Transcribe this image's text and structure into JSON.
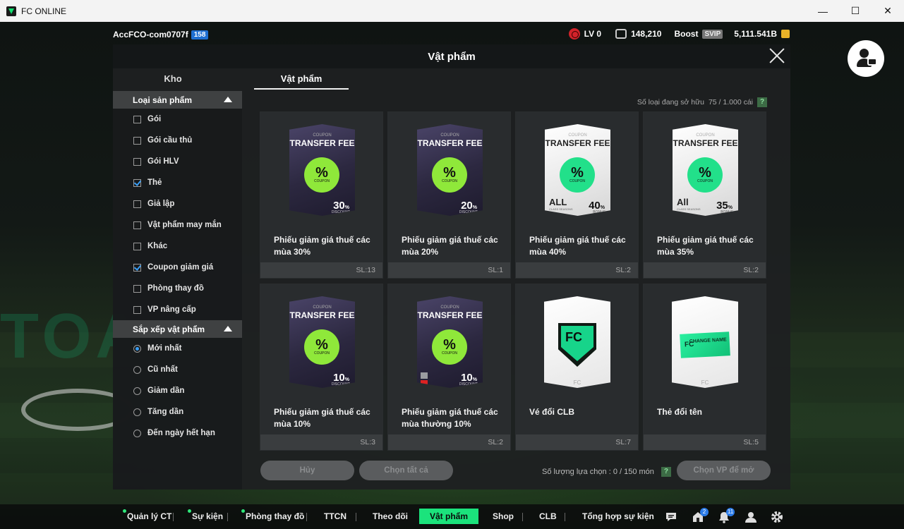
{
  "window": {
    "title": "FC ONLINE",
    "min": "—",
    "max": "☐",
    "close": "✕"
  },
  "bg_text": "TOA",
  "account": {
    "name": "AccFCO-com0707f",
    "level": "158"
  },
  "hud": {
    "lv": "LV 0",
    "bp": "148,210",
    "boost": "Boost",
    "svip": "SVIP",
    "coins": "5,111.541B"
  },
  "modal": {
    "title": "Vật phẩm",
    "tabs": [
      "Kho",
      "Vật phẩm"
    ],
    "owned_label": "Số loại đang sở hữu",
    "owned_value": "75 / 1.000 cái",
    "help": "?"
  },
  "filters": {
    "product_header": "Loại sản phẩm",
    "products": [
      {
        "label": "Gói",
        "checked": false
      },
      {
        "label": "Gói cầu thủ",
        "checked": false
      },
      {
        "label": "Gói HLV",
        "checked": false
      },
      {
        "label": "Thẻ",
        "checked": true
      },
      {
        "label": "Giả lập",
        "checked": false
      },
      {
        "label": "Vật phẩm may mắn",
        "checked": false
      },
      {
        "label": "Khác",
        "checked": false
      },
      {
        "label": "Coupon giảm giá",
        "checked": true
      },
      {
        "label": "Phòng thay đồ",
        "checked": false
      },
      {
        "label": "VP nâng cấp",
        "checked": false
      }
    ],
    "sort_header": "Sắp xếp vật phẩm",
    "sorts": [
      {
        "label": "Mới nhất",
        "selected": true
      },
      {
        "label": "Cũ nhất",
        "selected": false
      },
      {
        "label": "Giảm dần",
        "selected": false
      },
      {
        "label": "Tăng dần",
        "selected": false
      },
      {
        "label": "Đến ngày hết hạn",
        "selected": false
      }
    ]
  },
  "items": [
    {
      "name": "Phiếu giảm giá thuế các mùa 30%",
      "qty": "SL:13",
      "kind": "coupon",
      "style": "dark",
      "coupon_label": "COUPON",
      "title": "TRANSFER FEE",
      "seal": "%",
      "seal_sub": "COUPON",
      "pct": "30",
      "pct_sub": "DISCOUNT"
    },
    {
      "name": "Phiếu giảm giá thuế các mùa 20%",
      "qty": "SL:1",
      "kind": "coupon",
      "style": "dark",
      "coupon_label": "COUPON",
      "title": "TRANSFER FEE",
      "seal": "%",
      "seal_sub": "COUPON",
      "pct": "20",
      "pct_sub": "DISCOUNT"
    },
    {
      "name": "Phiếu giảm giá thuế các mùa 40%",
      "qty": "SL:2",
      "kind": "coupon",
      "style": "light",
      "coupon_label": "COUPON",
      "title": "TRANSFER FEE",
      "seal": "%",
      "seal_sub": "COUPON",
      "pct": "40",
      "pct_sub": "BONUS",
      "all": "ALL",
      "all_sub": "CLASS SEASONS"
    },
    {
      "name": "Phiếu giảm giá thuế các mùa 35%",
      "qty": "SL:2",
      "kind": "coupon",
      "style": "light",
      "coupon_label": "COUPON",
      "title": "TRANSFER FEE",
      "seal": "%",
      "seal_sub": "COUPON",
      "pct": "35",
      "pct_sub": "BONUS",
      "all": "All",
      "all_sub": "CLASS SEASONS"
    },
    {
      "name": "Phiếu giảm giá thuế các mùa 10%",
      "qty": "SL:3",
      "kind": "coupon",
      "style": "dark",
      "coupon_label": "COUPON",
      "title": "TRANSFER FEE",
      "seal": "%",
      "seal_sub": "COUPON",
      "pct": "10",
      "pct_sub": "DISCOUNT"
    },
    {
      "name": "Phiếu giảm giá thuế các mùa thường 10%",
      "qty": "SL:2",
      "kind": "coupon",
      "style": "dark",
      "coupon_label": "COUPON",
      "title": "TRANSFER FEE",
      "seal": "%",
      "seal_sub": "COUPON",
      "pct": "10",
      "pct_sub": "DISCOUNT",
      "locked": true
    },
    {
      "name": "Vé đổi CLB",
      "qty": "SL:7",
      "kind": "club",
      "emblem": "FC",
      "foot": "FC"
    },
    {
      "name": "Thẻ đổi tên",
      "qty": "SL:5",
      "kind": "rename",
      "ticket": "CHANGE NAME",
      "foot": "FC"
    }
  ],
  "actions": {
    "cancel": "Hủy",
    "select_all": "Chọn tất cả",
    "count_label": "Số lượng lựa chọn : 0 / 150 món",
    "sell": "Chọn VP để mở"
  },
  "nav": {
    "items": [
      "Quản lý CT",
      "Sự kiện",
      "Phòng thay đồ",
      "TTCN",
      "Theo dõi",
      "Vật phẩm",
      "Shop",
      "CLB",
      "Tổng hợp sự kiện"
    ],
    "home_badge": "2",
    "bell_badge": "11"
  },
  "colors": {
    "accent": "#1be37c",
    "check": "#3a9ef5",
    "level_badge": "#1f6fd1"
  }
}
